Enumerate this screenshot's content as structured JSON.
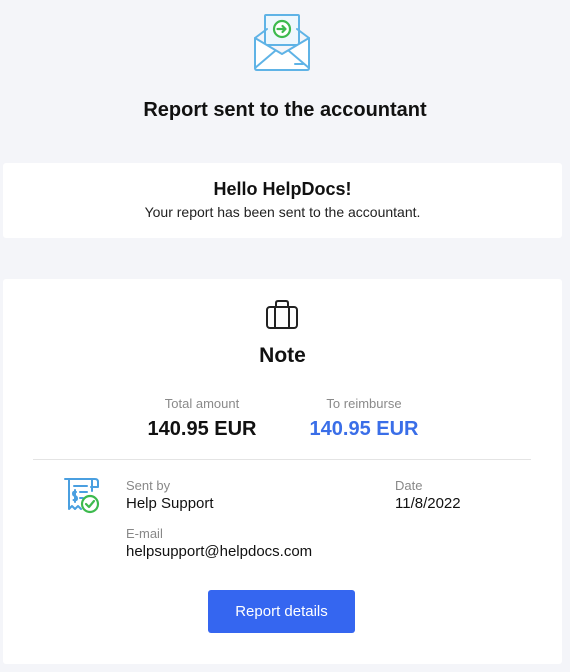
{
  "header": {
    "icon": "envelope-arrow-icon",
    "title": "Report sent to the accountant"
  },
  "greeting": {
    "title": "Hello HelpDocs!",
    "message": "Your report has been sent to the accountant."
  },
  "note": {
    "icon": "suitcase-icon",
    "title": "Note",
    "total_amount": {
      "label": "Total amount",
      "value": "140.95 EUR"
    },
    "to_reimburse": {
      "label": "To reimburse",
      "value": "140.95 EUR"
    },
    "details_icon": "receipt-check-icon",
    "sent_by": {
      "label": "Sent by",
      "value": "Help Support"
    },
    "date": {
      "label": "Date",
      "value": "11/8/2022"
    },
    "email": {
      "label": "E-mail",
      "value": "helpsupport@helpdocs.com"
    },
    "button_label": "Report details"
  },
  "colors": {
    "accent": "#3566f0",
    "reimburse": "#3a6ee8",
    "icon_blue": "#5fb3e6",
    "icon_green": "#3dba4e",
    "background": "#f4f5f9"
  }
}
